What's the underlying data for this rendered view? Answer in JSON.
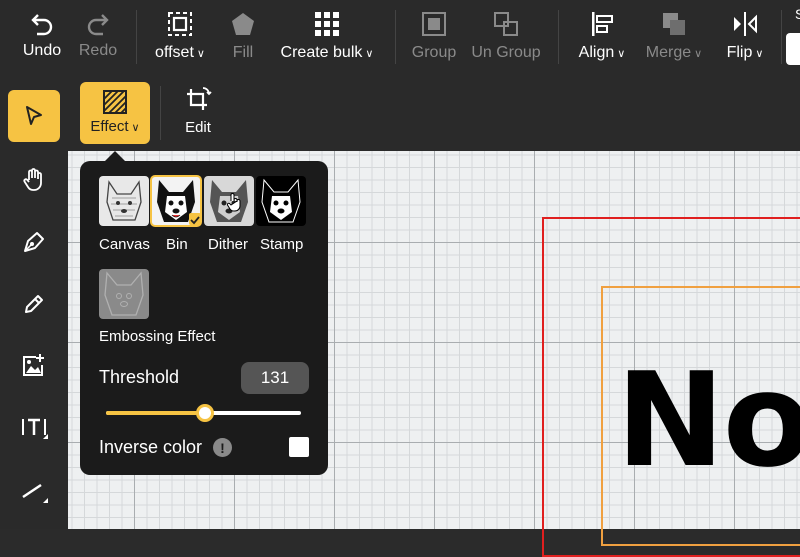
{
  "toolbar": {
    "undo": "Undo",
    "redo": "Redo",
    "offset": "offset",
    "fill": "Fill",
    "create_bulk": "Create bulk",
    "group": "Group",
    "ungroup": "Un Group",
    "align": "Align",
    "merge": "Merge",
    "flip": "Flip",
    "right_letter": "S"
  },
  "subbar": {
    "effect": "Effect",
    "edit": "Edit"
  },
  "effects_panel": {
    "effects": [
      {
        "label": "Canvas",
        "selected": false
      },
      {
        "label": "Bin",
        "selected": true
      },
      {
        "label": "Dither",
        "selected": false
      },
      {
        "label": "Stamp",
        "selected": false
      }
    ],
    "embossing_label": "Embossing Effect",
    "threshold_label": "Threshold",
    "threshold_value": "131",
    "threshold_fraction": 0.51,
    "inverse_label": "Inverse color",
    "info_glyph": "!",
    "inverse_checked": false
  },
  "canvas": {
    "text": "No"
  },
  "colors": {
    "accent": "#f6c343",
    "toolbar_bg": "#2a2a2a",
    "panel_bg": "#1b1b1b",
    "red_outline": "#e01f1f",
    "orange_outline": "#f0a040"
  }
}
